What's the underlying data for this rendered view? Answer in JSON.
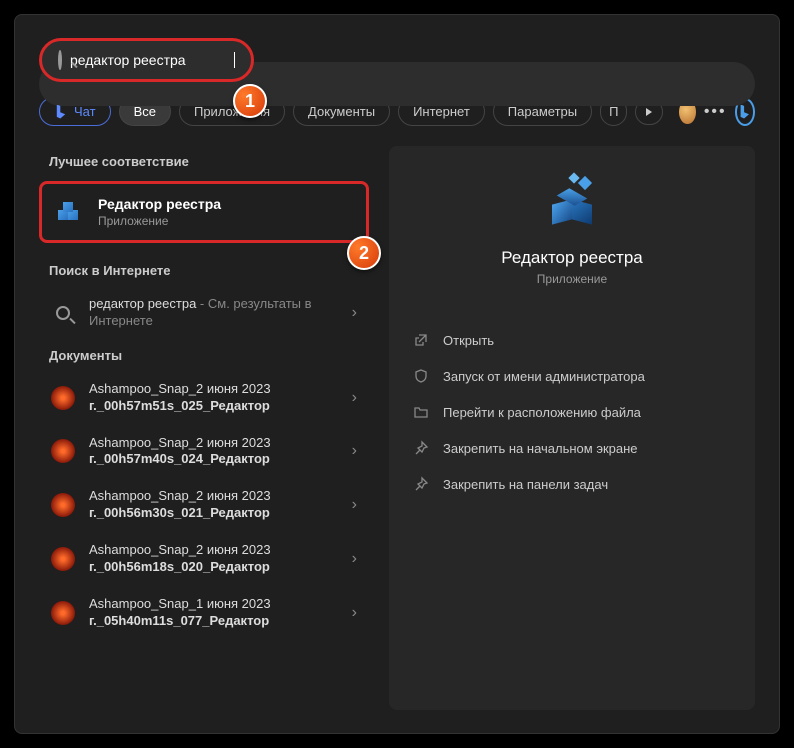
{
  "search": {
    "value": "редактор реестра"
  },
  "filters": {
    "chat": "Чат",
    "all": "Все",
    "apps": "Приложения",
    "docs": "Документы",
    "web": "Интернет",
    "settings": "Параметры",
    "more_letter": "П"
  },
  "callouts": {
    "one": "1",
    "two": "2"
  },
  "sections": {
    "best_match": "Лучшее соответствие",
    "web_search": "Поиск в Интернете",
    "documents": "Документы"
  },
  "best_match": {
    "title": "Редактор реестра",
    "subtitle": "Приложение"
  },
  "web_result": {
    "query": "редактор реестра",
    "suffix": " - См. результаты в Интернете"
  },
  "documents": [
    {
      "line1": "Ashampoo_Snap_2 июня 2023",
      "line2": "г._00h57m51s_025_Редактор"
    },
    {
      "line1": "Ashampoo_Snap_2 июня 2023",
      "line2": "г._00h57m40s_024_Редактор"
    },
    {
      "line1": "Ashampoo_Snap_2 июня 2023",
      "line2": "г._00h56m30s_021_Редактор"
    },
    {
      "line1": "Ashampoo_Snap_2 июня 2023",
      "line2": "г._00h56m18s_020_Редактор"
    },
    {
      "line1": "Ashampoo_Snap_1 июня 2023",
      "line2": "г._05h40m11s_077_Редактор"
    }
  ],
  "detail": {
    "title": "Редактор реестра",
    "subtitle": "Приложение",
    "actions": [
      {
        "icon": "open-icon",
        "label": "Открыть"
      },
      {
        "icon": "admin-icon",
        "label": "Запуск от имени администратора"
      },
      {
        "icon": "folder-icon",
        "label": "Перейти к расположению файла"
      },
      {
        "icon": "pin-start-icon",
        "label": "Закрепить на начальном экране"
      },
      {
        "icon": "pin-taskbar-icon",
        "label": "Закрепить на панели задач"
      }
    ]
  }
}
